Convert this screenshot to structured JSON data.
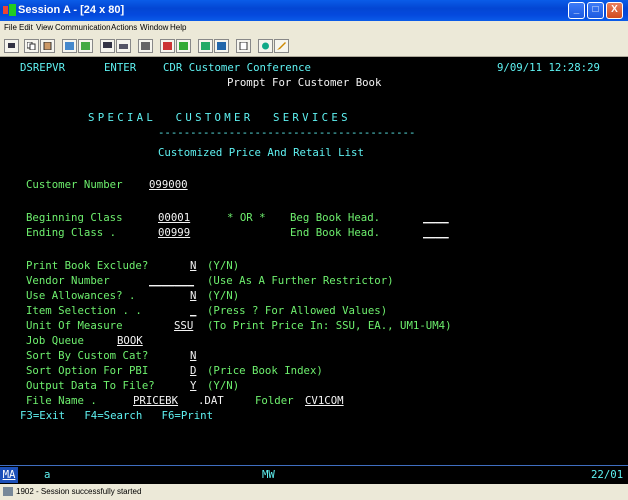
{
  "window": {
    "title": "Session A - [24 x 80]",
    "controls": {
      "minimize": "_",
      "maximize": "□",
      "close": "X"
    }
  },
  "menu": [
    "File",
    "Edit",
    "View",
    "Communication",
    "Actions",
    "Window",
    "Help"
  ],
  "toolbar_icons": [
    "print-screen-icon",
    "copy-icon",
    "paste-icon",
    "send-icon",
    "receive-icon",
    "display-icon",
    "keyboard-icon",
    "macro-icon",
    "record-icon",
    "playback-icon",
    "color-icon",
    "map-icon",
    "clipboard-icon",
    "globe-icon",
    "edit-icon"
  ],
  "terminal": {
    "program": "DSREPVR",
    "mode": "ENTER",
    "company": "CDR Customer Conference",
    "datetime": "9/09/11 12:28:29",
    "screen_title": "Prompt For Customer Book",
    "banner": "SPECIAL  CUSTOMER  SERVICES",
    "divider": "----------------------------------------",
    "subtitle": "Customized Price And Retail List",
    "customer_number": {
      "label": "Customer Number",
      "value": "099000"
    },
    "beginning_class": {
      "label": "Beginning Class",
      "value": "00001"
    },
    "or_text": "* OR *",
    "beg_book_head": {
      "label": "Beg Book Head.",
      "value": "____"
    },
    "ending_class": {
      "label": "Ending Class .",
      "value": "00999"
    },
    "end_book_head": {
      "label": "End Book Head.",
      "value": "____"
    },
    "print_book_exclude": {
      "label": "Print Book Exclude?",
      "value": "N",
      "hint": "(Y/N)"
    },
    "vendor_number": {
      "label": "Vendor Number",
      "value": "_______",
      "hint": "(Use As A Further Restrictor)"
    },
    "use_allowances": {
      "label": "Use Allowances? .",
      "value": "N",
      "hint": "(Y/N)"
    },
    "item_selection": {
      "label": "Item Selection . .",
      "value": "_",
      "hint": "(Press ? For Allowed Values)"
    },
    "unit_of_measure": {
      "label": "Unit Of Measure",
      "value": "SSU",
      "hint": "(To Print Price In: SSU, EA., UM1-UM4)"
    },
    "job_queue": {
      "label": "Job Queue",
      "value": "BOOK"
    },
    "sort_custom_cat": {
      "label": "Sort By Custom Cat?",
      "value": "N"
    },
    "sort_option_pbi": {
      "label": "Sort Option For PBI",
      "value": "D",
      "hint": "(Price Book Index)"
    },
    "output_to_file": {
      "label": "Output Data To File?",
      "value": "Y",
      "hint": "(Y/N)"
    },
    "file_name": {
      "label": "File Name .",
      "value": "PRICEBK",
      "ext": ".DAT",
      "folder_label": "Folder",
      "folder_value": "CV1COM"
    },
    "function_keys": "F3=Exit   F4=Search   F6=Print"
  },
  "oia": {
    "indicator": "MA",
    "session": "a",
    "mode": "MW",
    "cursor": "22/01"
  },
  "status": "1902 - Session successfully started"
}
